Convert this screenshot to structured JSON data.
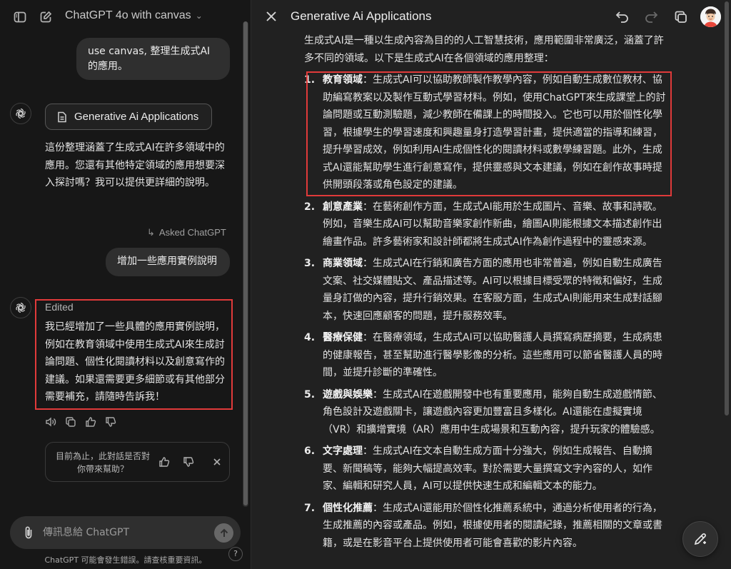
{
  "header": {
    "model_title": "ChatGPT 4o with canvas"
  },
  "chat": {
    "user_message_1": "use canvas, 整理生成式AI的應用。",
    "canvas_chip_label": "Generative Ai Applications",
    "bot_message_1": "這份整理涵蓋了生成式AI在許多領域中的應用。您還有其他特定領域的應用想要深入探討嗎？我可以提供更詳細的說明。",
    "asked_label": "Asked ChatGPT",
    "user_message_2": "增加一些應用實例說明",
    "edited_label": "Edited",
    "bot_message_2": "我已經增加了一些具體的應用實例說明，例如在教育領域中使用生成式AI來生成討論問題、個性化閱讀材料以及創意寫作的建議。如果還需要更多細節或有其他部分需要補充，請隨時告訴我！",
    "feedback_question": "目前為止，此對話是否對你帶來幫助？"
  },
  "composer": {
    "placeholder": "傳訊息給 ChatGPT",
    "disclaimer": "ChatGPT 可能會發生錯誤。請查核重要資訊。",
    "help_label": "?"
  },
  "document": {
    "title": "Generative Ai Applications",
    "intro": "生成式AI是一種以生成內容為目的的人工智慧技術，應用範圍非常廣泛，涵蓋了許多不同的領域。以下是生成式AI在各個領域的應用整理：",
    "items": [
      {
        "num": "1.",
        "head": "教育領域",
        "body": "：生成式AI可以協助教師製作教學內容，例如自動生成數位教材、協助編寫教案以及製作互動式學習材料。例如，使用ChatGPT來生成課堂上的討論問題或互動測驗題，減少教師在備課上的時間投入。它也可以用於個性化學習，根據學生的學習速度和興趣量身打造學習計畫，提供適當的指導和練習，提升學習成效，例如利用AI生成個性化的閱讀材料或數學練習題。此外，生成式AI還能幫助學生進行創意寫作，提供靈感與文本建議，例如在創作故事時提供開頭段落或角色設定的建議。"
      },
      {
        "num": "2.",
        "head": "創意產業",
        "body": "：在藝術創作方面，生成式AI能用於生成圖片、音樂、故事和詩歌。例如，音樂生成AI可以幫助音樂家創作新曲，繪圖AI則能根據文本描述創作出繪畫作品。許多藝術家和設計師都將生成式AI作為創作過程中的靈感來源。"
      },
      {
        "num": "3.",
        "head": "商業領域",
        "body": "：生成式AI在行銷和廣告方面的應用也非常普遍，例如自動生成廣告文案、社交媒體貼文、產品描述等。AI可以根據目標受眾的特徵和偏好，生成量身訂做的內容，提升行銷效果。在客服方面，生成式AI則能用來生成對話腳本，快速回應顧客的問題，提升服務效率。"
      },
      {
        "num": "4.",
        "head": "醫療保健",
        "body": "：在醫療領域，生成式AI可以協助醫護人員撰寫病歷摘要，生成病患的健康報告，甚至幫助進行醫學影像的分析。這些應用可以節省醫護人員的時間，並提升診斷的準確性。"
      },
      {
        "num": "5.",
        "head": "遊戲與娛樂",
        "body": "：生成式AI在遊戲開發中也有重要應用，能夠自動生成遊戲情節、角色設計及遊戲關卡，讓遊戲內容更加豐富且多樣化。AI還能在虛擬實境（VR）和擴增實境（AR）應用中生成場景和互動內容，提升玩家的體驗感。"
      },
      {
        "num": "6.",
        "head": "文字處理",
        "body": "：生成式AI在文本自動生成方面十分強大，例如生成報告、自動摘要、新聞稿等，能夠大幅提高效率。對於需要大量撰寫文字內容的人，如作家、編輯和研究人員，AI可以提供快速生成和編輯文本的能力。"
      },
      {
        "num": "7.",
        "head": "個性化推薦",
        "body": "：生成式AI還能用於個性化推薦系統中，通過分析使用者的行為，生成推薦的內容或產品。例如，根據使用者的閱讀紀錄，推薦相關的文章或書籍，或是在影音平台上提供使用者可能會喜歡的影片內容。"
      }
    ]
  },
  "colors": {
    "highlight_border": "#e03a3a",
    "panel_dark": "#171717",
    "canvas_bg": "#212121"
  }
}
